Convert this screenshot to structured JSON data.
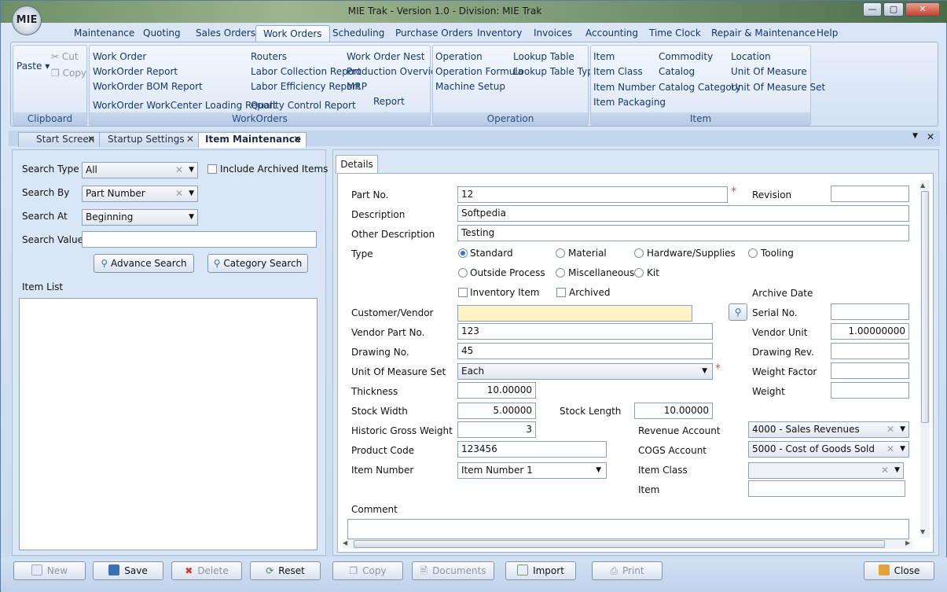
{
  "window": {
    "title": "MIE Trak - Version 1.0 - Division:  MIE Trak",
    "logo_text": "MIE"
  },
  "ribbon_tabs": [
    "Maintenance",
    "Quoting",
    "Sales Orders",
    "Work Orders",
    "Scheduling",
    "Purchase Orders",
    "Inventory",
    "Invoices",
    "Accounting",
    "Time Clock",
    "Repair & Maintenance",
    "Help"
  ],
  "clipboard": {
    "paste": "Paste",
    "cut": "Cut",
    "copy": "Copy",
    "label": "Clipboard"
  },
  "workorders": {
    "label": "WorkOrders",
    "items": [
      "Work Order",
      "WorkOrder Report",
      "WorkOrder BOM Report",
      "WorkOrder WorkCenter Loading Report",
      "Routers",
      "Labor Collection Report",
      "Labor Efficiency Report",
      "Quality Control Report",
      "Work Order Nest",
      "Production Overview",
      "MRP",
      "Report"
    ]
  },
  "operation": {
    "label": "Operation",
    "items": [
      "Operation",
      "Operation Formula",
      "Machine Setup",
      "Lookup Table",
      "Lookup Table Type"
    ]
  },
  "item_group": {
    "label": "Item",
    "items": [
      "Item",
      "Item Class",
      "Item Number",
      "Item Packaging",
      "Commodity",
      "Catalog",
      "Catalog Category",
      "Location",
      "Unit Of Measure",
      "Unit Of Measure Set"
    ]
  },
  "doc_tabs": [
    "Start Screen",
    "Startup Settings",
    "Item Maintenance"
  ],
  "search": {
    "type_label": "Search Type",
    "type_value": "All",
    "include_archived": "Include Archived Items",
    "by_label": "Search By",
    "by_value": "Part Number",
    "at_label": "Search At",
    "at_value": "Beginning",
    "value_label": "Search Value",
    "value": "",
    "advance_btn": "Advance Search",
    "category_btn": "Category Search",
    "item_list_label": "Item List"
  },
  "details": {
    "tab": "Details",
    "part_no_label": "Part No.",
    "part_no": "12",
    "revision_label": "Revision",
    "revision": "",
    "description_label": "Description",
    "description": "Softpedia",
    "other_desc_label": "Other Description",
    "other_desc": "Testing",
    "type_label": "Type",
    "types": [
      "Standard",
      "Material",
      "Hardware/Supplies",
      "Tooling",
      "Outside Process",
      "Miscellaneous",
      "Kit"
    ],
    "inventory_item": "Inventory Item",
    "archived": "Archived",
    "archive_date_label": "Archive Date",
    "customer_vendor_label": "Customer/Vendor",
    "customer_vendor": "",
    "serial_no_label": "Serial No.",
    "serial_no": "",
    "vendor_part_label": "Vendor Part No.",
    "vendor_part": "123",
    "vendor_unit_label": "Vendor Unit",
    "vendor_unit": "1.00000000",
    "drawing_no_label": "Drawing No.",
    "drawing_no": "45",
    "drawing_rev_label": "Drawing Rev.",
    "drawing_rev": "",
    "uom_set_label": "Unit Of Measure Set",
    "uom_set": "Each",
    "weight_factor_label": "Weight Factor",
    "weight_factor": "",
    "thickness_label": "Thickness",
    "thickness": "10.00000",
    "weight_label": "Weight",
    "weight": "",
    "stock_width_label": "Stock Width",
    "stock_width": "5.00000",
    "stock_length_label": "Stock Length",
    "stock_length": "10.00000",
    "hist_gross_label": "Historic Gross Weight",
    "hist_gross": "3",
    "revenue_label": "Revenue Account",
    "revenue": "4000 - Sales Revenues",
    "product_code_label": "Product Code",
    "product_code": "123456",
    "cogs_label": "COGS Account",
    "cogs": "5000 - Cost of Goods Sold",
    "item_number_label": "Item Number",
    "item_number": "Item Number 1",
    "item_class_label": "Item Class",
    "item_class": "",
    "item_label": "Item",
    "item": "",
    "comment_label": "Comment"
  },
  "bottom_buttons": {
    "new": "New",
    "save": "Save",
    "delete": "Delete",
    "reset": "Reset",
    "copy": "Copy",
    "documents": "Documents",
    "import": "Import",
    "print": "Print",
    "close": "Close"
  }
}
